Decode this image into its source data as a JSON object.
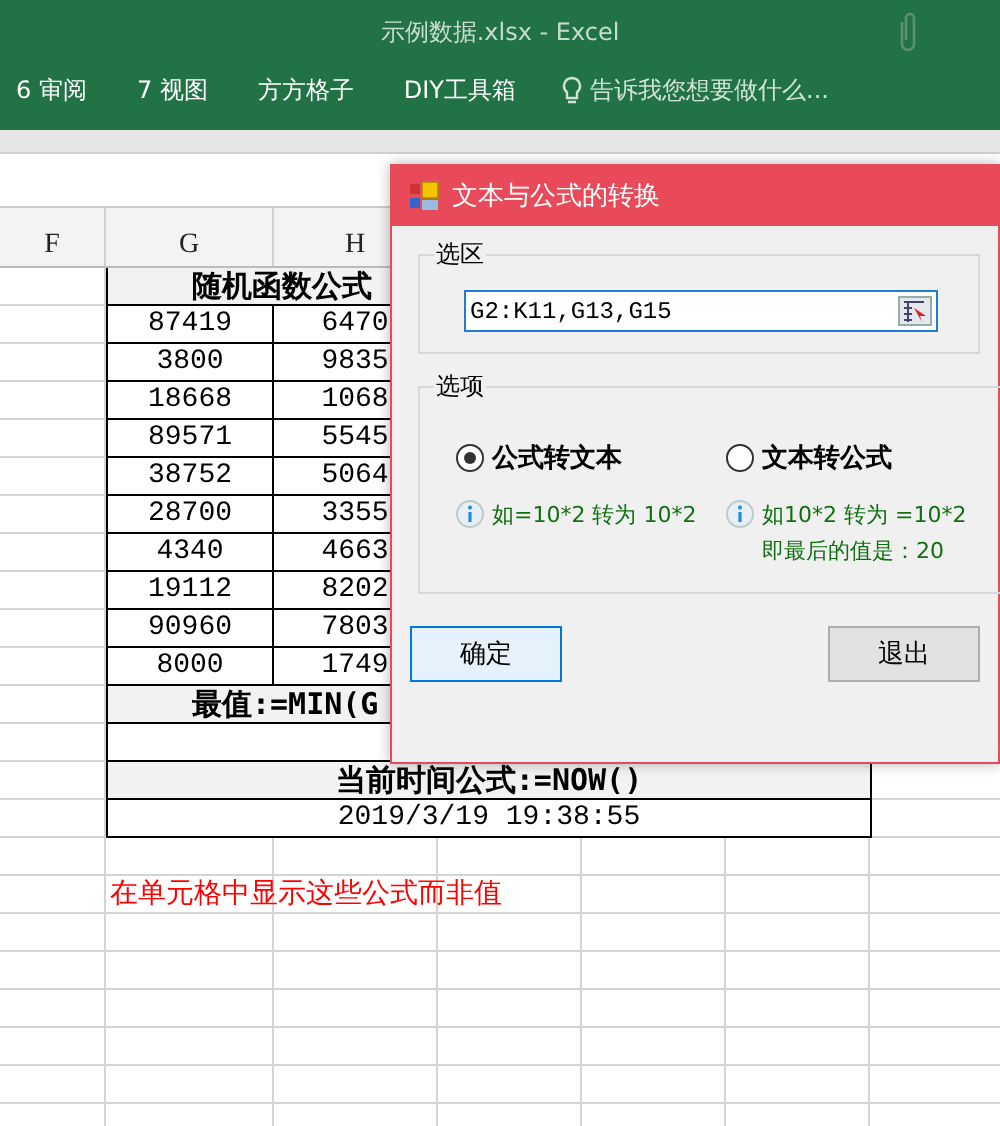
{
  "window": {
    "title": "示例数据.xlsx - Excel"
  },
  "ribbon_tabs": [
    {
      "label": "6 审阅"
    },
    {
      "label": "7 视图"
    },
    {
      "label": "方方格子"
    },
    {
      "label": "DIY工具箱"
    }
  ],
  "tell_me": {
    "placeholder": "告诉我您想要做什么..."
  },
  "sheet": {
    "columns": [
      "F",
      "G",
      "H"
    ],
    "title_row": "随机函数公式",
    "rows": [
      [
        "",
        "87419",
        "6470"
      ],
      [
        "",
        "3800",
        "9835"
      ],
      [
        "",
        "18668",
        "1068"
      ],
      [
        "",
        "89571",
        "5545"
      ],
      [
        "",
        "38752",
        "5064"
      ],
      [
        "",
        "28700",
        "3355"
      ],
      [
        "",
        "4340",
        "4663"
      ],
      [
        "",
        "19112",
        "8202"
      ],
      [
        "",
        "90960",
        "7803"
      ],
      [
        "",
        "8000",
        "1749"
      ]
    ],
    "min_row": "最值:=MIN(G",
    "now_row": "当前时间公式:=NOW()",
    "date_row": "2019/3/19 19:38:55",
    "note": "在单元格中显示这些公式而非值"
  },
  "dialog": {
    "title": "文本与公式的转换",
    "range_group": {
      "label": "选区",
      "value": "G2:K11,G13,G15"
    },
    "options_group": {
      "label": "选项",
      "options": [
        {
          "label": "公式转文本",
          "selected": true,
          "hints": [
            "如=10*2 转为 10*2"
          ]
        },
        {
          "label": "文本转公式",
          "selected": false,
          "hints": [
            "如10*2 转为 =10*2",
            "即最后的值是：20"
          ]
        }
      ]
    },
    "buttons": [
      {
        "label": "确定",
        "focused": true
      },
      {
        "label": "退出",
        "focused": false
      }
    ]
  }
}
